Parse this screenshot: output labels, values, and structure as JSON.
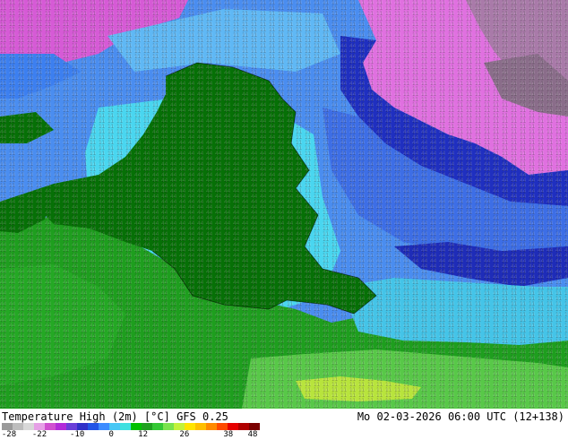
{
  "map": {
    "title": "Temperature High (2m) [°C] GFS 0.25",
    "valid_time": "Mo 02-03-2026 06:00 UTC (12+138)",
    "legend": {
      "colors": [
        "#9a9a9a",
        "#bdbdbd",
        "#d8d8d8",
        "#e6a0e6",
        "#d050d0",
        "#b22bd9",
        "#6a3fd8",
        "#3030c8",
        "#2255e6",
        "#3c8cff",
        "#47c7f5",
        "#3fe0e0",
        "#00c000",
        "#20a020",
        "#34c834",
        "#7ae34c",
        "#c3f23a",
        "#ffe400",
        "#ffbf00",
        "#ff8a00",
        "#ff4a00",
        "#e60000",
        "#b00000",
        "#7a0000"
      ],
      "ticks": [
        "-28",
        "-22",
        "-10",
        "0",
        "12",
        "26",
        "38",
        "48"
      ]
    }
  }
}
